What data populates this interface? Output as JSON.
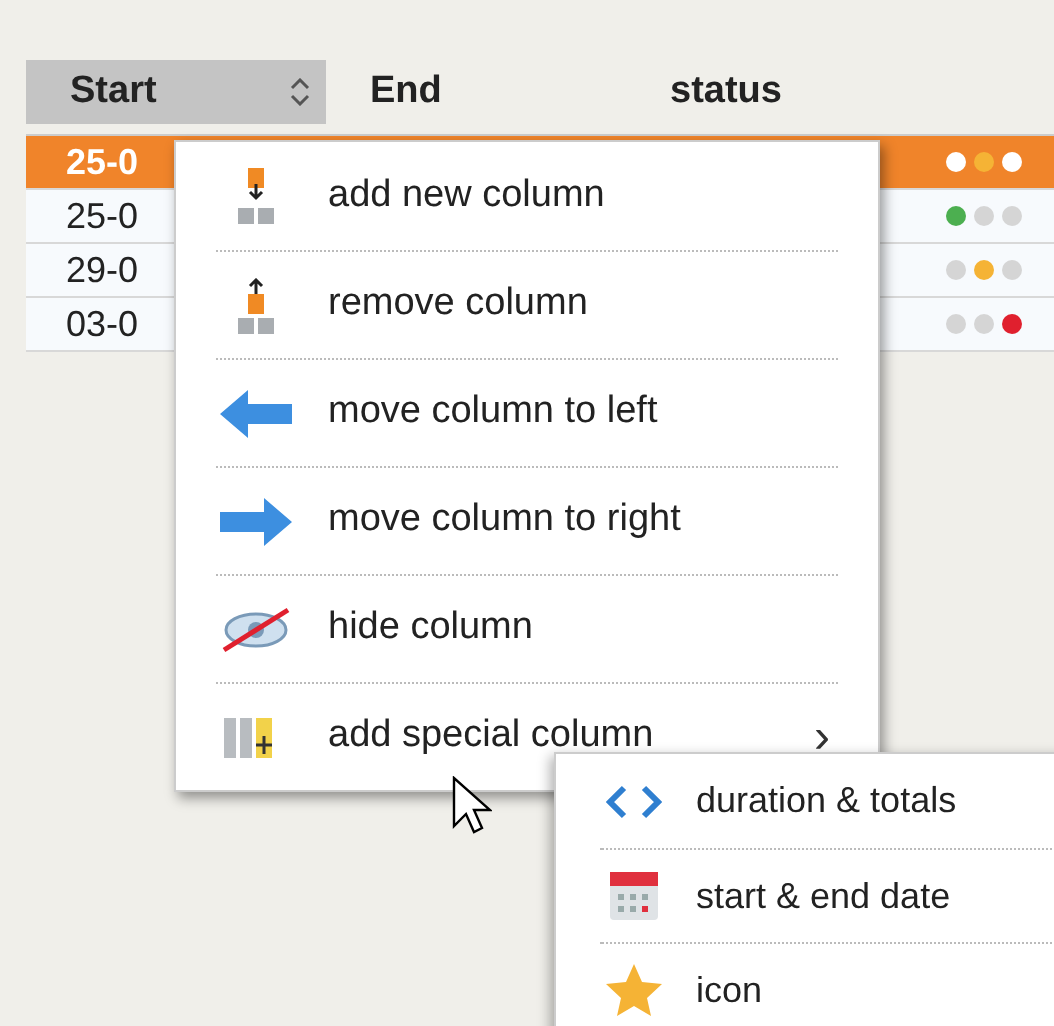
{
  "table": {
    "columns": [
      {
        "label": "Start",
        "sorted": true
      },
      {
        "label": "End",
        "sorted": false
      },
      {
        "label": "status",
        "sorted": false
      }
    ],
    "rows": [
      {
        "start": "25-0",
        "selected": true,
        "status": [
          {
            "color": "#ffffff"
          },
          {
            "color": "#f5b335"
          },
          {
            "color": "#ffffff"
          }
        ]
      },
      {
        "start": "25-0",
        "selected": false,
        "status": [
          {
            "color": "#4caf50"
          },
          {
            "color": "#d5d5d5"
          },
          {
            "color": "#d5d5d5"
          }
        ]
      },
      {
        "start": "29-0",
        "selected": false,
        "status": [
          {
            "color": "#d5d5d5"
          },
          {
            "color": "#f5b335"
          },
          {
            "color": "#d5d5d5"
          }
        ]
      },
      {
        "start": "03-0",
        "selected": false,
        "status": [
          {
            "color": "#d5d5d5"
          },
          {
            "color": "#d5d5d5"
          },
          {
            "color": "#e0202e"
          }
        ]
      }
    ]
  },
  "context_menu": {
    "items": [
      {
        "kind": "add",
        "label": "add new column"
      },
      {
        "kind": "remove",
        "label": "remove column"
      },
      {
        "kind": "left",
        "label": "move column to left"
      },
      {
        "kind": "right",
        "label": "move column to right"
      },
      {
        "kind": "hide",
        "label": "hide column"
      },
      {
        "kind": "special",
        "label": "add special column",
        "chevron": "›"
      }
    ]
  },
  "submenu": {
    "items": [
      {
        "kind": "code",
        "label": "duration & totals"
      },
      {
        "kind": "calendar",
        "label": "start & end date"
      },
      {
        "kind": "star",
        "label": "icon"
      }
    ]
  }
}
